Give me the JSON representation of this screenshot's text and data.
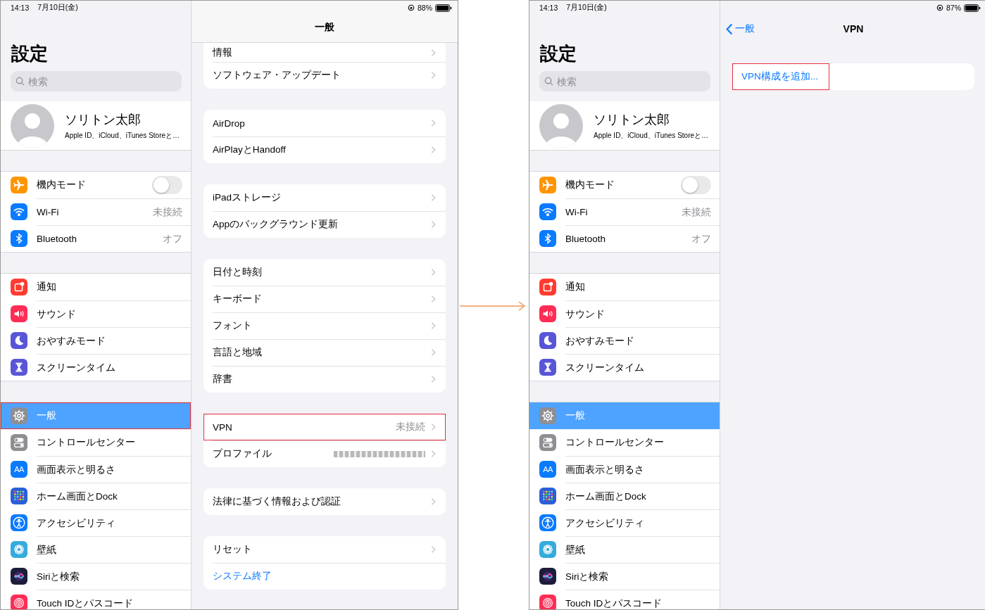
{
  "screens": [
    {
      "status": {
        "time": "14:13",
        "date": "7月10日(金)",
        "battery": "88%"
      },
      "sidebar": {
        "title": "設定",
        "search": {
          "placeholder": "検索"
        },
        "profile": {
          "name": "ソリトン太郎",
          "subtitle": "Apple ID、iCloud、iTunes Storeと…"
        },
        "groups": [
          [
            {
              "label": "機内モード",
              "color": "#ff9500",
              "kind": "toggle",
              "on": false,
              "selected": false,
              "outlined": false
            },
            {
              "label": "Wi-Fi",
              "color": "#0a7aff",
              "kind": "value",
              "value": "未接続",
              "selected": false,
              "outlined": false
            },
            {
              "label": "Bluetooth",
              "color": "#0a7aff",
              "kind": "value",
              "value": "オフ",
              "selected": false,
              "outlined": false
            }
          ],
          [
            {
              "label": "通知",
              "color": "#ff3b30",
              "kind": "plain",
              "selected": false,
              "outlined": false
            },
            {
              "label": "サウンド",
              "color": "#ff2d55",
              "kind": "plain",
              "selected": false,
              "outlined": false
            },
            {
              "label": "おやすみモード",
              "color": "#5856d6",
              "kind": "plain",
              "selected": false,
              "outlined": false
            },
            {
              "label": "スクリーンタイム",
              "color": "#5856d6",
              "kind": "plain",
              "selected": false,
              "outlined": false
            }
          ],
          [
            {
              "label": "一般",
              "color": "#8e8e93",
              "kind": "plain",
              "selected": true,
              "outlined": true
            },
            {
              "label": "コントロールセンター",
              "color": "#8e8e93",
              "kind": "plain",
              "selected": false,
              "outlined": false
            },
            {
              "label": "画面表示と明るさ",
              "icon_text": "AA",
              "color": "#0a7aff",
              "kind": "plain",
              "selected": false,
              "outlined": false
            },
            {
              "label": "ホーム画面とDock",
              "color": "#2c5ed8",
              "kind": "plain",
              "selected": false,
              "outlined": false
            },
            {
              "label": "アクセシビリティ",
              "color": "#0a7aff",
              "kind": "plain",
              "selected": false,
              "outlined": false
            },
            {
              "label": "壁紙",
              "color": "#35aadc",
              "kind": "plain",
              "selected": false,
              "outlined": false
            },
            {
              "label": "Siriと検索",
              "color": "#1d1d3a",
              "kind": "plain",
              "selected": false,
              "outlined": false
            },
            {
              "label": "Touch IDとパスコード",
              "color": "#ff2d55",
              "kind": "plain",
              "selected": false,
              "outlined": false
            }
          ]
        ]
      },
      "detail": {
        "title": "一般",
        "groups": [
          {
            "scrolled": true,
            "rows": [
              {
                "label": "情報",
                "kind": "nav",
                "outlined": false
              },
              {
                "label": "ソフトウェア・アップデート",
                "kind": "nav",
                "outlined": false
              }
            ]
          },
          {
            "scrolled": false,
            "rows": [
              {
                "label": "AirDrop",
                "kind": "nav",
                "outlined": false
              },
              {
                "label": "AirPlayとHandoff",
                "kind": "nav",
                "outlined": false
              }
            ]
          },
          {
            "scrolled": false,
            "rows": [
              {
                "label": "iPadストレージ",
                "kind": "nav",
                "outlined": false
              },
              {
                "label": "Appのバックグラウンド更新",
                "kind": "nav",
                "outlined": false
              }
            ]
          },
          {
            "scrolled": false,
            "rows": [
              {
                "label": "日付と時刻",
                "kind": "nav",
                "outlined": false
              },
              {
                "label": "キーボード",
                "kind": "nav",
                "outlined": false
              },
              {
                "label": "フォント",
                "kind": "nav",
                "outlined": false
              },
              {
                "label": "言語と地域",
                "kind": "nav",
                "outlined": false
              },
              {
                "label": "辞書",
                "kind": "nav",
                "outlined": false
              }
            ]
          },
          {
            "scrolled": false,
            "rows": [
              {
                "label": "VPN",
                "kind": "nav",
                "value": "未接続",
                "outlined": true
              },
              {
                "label": "プロファイル",
                "kind": "nav",
                "value_redacted": true,
                "outlined": false
              }
            ]
          },
          {
            "scrolled": false,
            "rows": [
              {
                "label": "法律に基づく情報および認証",
                "kind": "nav",
                "outlined": false
              }
            ]
          },
          {
            "scrolled": false,
            "rows": [
              {
                "label": "リセット",
                "kind": "nav",
                "outlined": false
              },
              {
                "label": "システム終了",
                "kind": "action",
                "outlined": false
              }
            ]
          }
        ]
      }
    },
    {
      "status": {
        "time": "14:13",
        "date": "7月10日(金)",
        "battery": "87%"
      },
      "sidebar": {
        "title": "設定",
        "search": {
          "placeholder": "検索"
        },
        "profile": {
          "name": "ソリトン太郎",
          "subtitle": "Apple ID、iCloud、iTunes Storeと…"
        },
        "groups": [
          [
            {
              "label": "機内モード",
              "color": "#ff9500",
              "kind": "toggle",
              "on": false,
              "selected": false,
              "outlined": false
            },
            {
              "label": "Wi-Fi",
              "color": "#0a7aff",
              "kind": "value",
              "value": "未接続",
              "selected": false,
              "outlined": false
            },
            {
              "label": "Bluetooth",
              "color": "#0a7aff",
              "kind": "value",
              "value": "オフ",
              "selected": false,
              "outlined": false
            }
          ],
          [
            {
              "label": "通知",
              "color": "#ff3b30",
              "kind": "plain",
              "selected": false,
              "outlined": false
            },
            {
              "label": "サウンド",
              "color": "#ff2d55",
              "kind": "plain",
              "selected": false,
              "outlined": false
            },
            {
              "label": "おやすみモード",
              "color": "#5856d6",
              "kind": "plain",
              "selected": false,
              "outlined": false
            },
            {
              "label": "スクリーンタイム",
              "color": "#5856d6",
              "kind": "plain",
              "selected": false,
              "outlined": false
            }
          ],
          [
            {
              "label": "一般",
              "color": "#8e8e93",
              "kind": "plain",
              "selected": true,
              "outlined": false
            },
            {
              "label": "コントロールセンター",
              "color": "#8e8e93",
              "kind": "plain",
              "selected": false,
              "outlined": false
            },
            {
              "label": "画面表示と明るさ",
              "icon_text": "AA",
              "color": "#0a7aff",
              "kind": "plain",
              "selected": false,
              "outlined": false
            },
            {
              "label": "ホーム画面とDock",
              "color": "#2c5ed8",
              "kind": "plain",
              "selected": false,
              "outlined": false
            },
            {
              "label": "アクセシビリティ",
              "color": "#0a7aff",
              "kind": "plain",
              "selected": false,
              "outlined": false
            },
            {
              "label": "壁紙",
              "color": "#35aadc",
              "kind": "plain",
              "selected": false,
              "outlined": false
            },
            {
              "label": "Siriと検索",
              "color": "#1d1d3a",
              "kind": "plain",
              "selected": false,
              "outlined": false
            },
            {
              "label": "Touch IDとパスコード",
              "color": "#ff2d55",
              "kind": "plain",
              "selected": false,
              "outlined": false
            }
          ]
        ]
      },
      "detail": {
        "title": "VPN",
        "back": "一般",
        "groups": [
          {
            "scrolled": false,
            "rows": [
              {
                "label": "VPN構成を追加...",
                "kind": "action",
                "outlined": true
              }
            ]
          }
        ]
      }
    }
  ]
}
